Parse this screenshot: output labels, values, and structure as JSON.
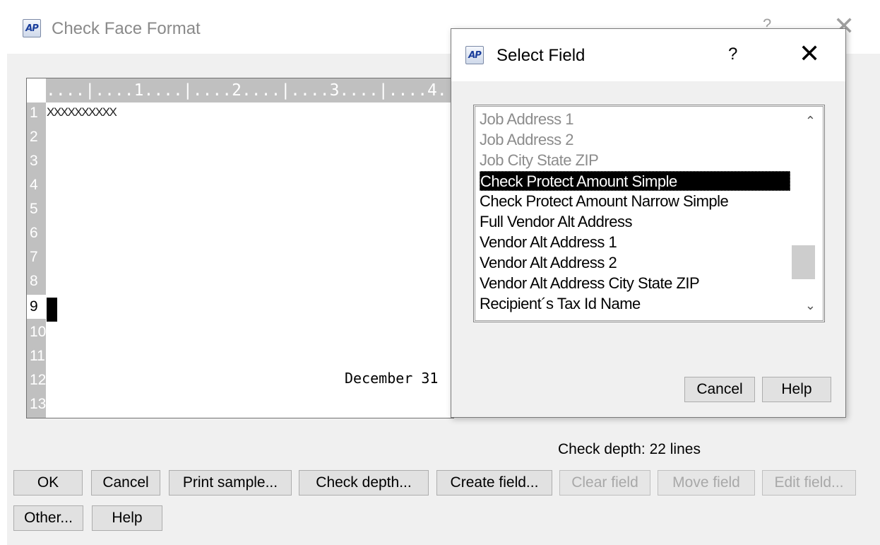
{
  "main": {
    "title": "Check Face Format",
    "help": "?",
    "close": "✕",
    "icon_text": "AP"
  },
  "editor": {
    "ruler": "....|....1....|....2....|....3....|....4....",
    "lines": [
      "1",
      "2",
      "3",
      "4",
      "5",
      "6",
      "7",
      "8",
      "9",
      "10",
      "11",
      "12",
      "13"
    ],
    "active_line": "9",
    "line1_text": "XXXXXXXXXX",
    "date_text": "December 31"
  },
  "status": {
    "check_depth": "Check depth: 22 lines"
  },
  "buttons": {
    "ok": "OK",
    "cancel": "Cancel",
    "print_sample": "Print sample...",
    "check_depth": "Check depth...",
    "create_field": "Create field...",
    "clear_field": "Clear field",
    "move_field": "Move field",
    "edit_field": "Edit field...",
    "other": "Other...",
    "help": "Help"
  },
  "dialog": {
    "title": "Select Field",
    "help": "?",
    "close": "✕",
    "icon_text": "AP",
    "items": [
      {
        "label": "Job Address 1",
        "state": "gray"
      },
      {
        "label": "Job Address 2",
        "state": "gray"
      },
      {
        "label": "Job City State ZIP",
        "state": "gray"
      },
      {
        "label": "Check Protect Amount Simple",
        "state": "selected"
      },
      {
        "label": "Check Protect Amount Narrow Simple",
        "state": "normal"
      },
      {
        "label": "Full Vendor Alt Address",
        "state": "normal"
      },
      {
        "label": "Vendor Alt Address 1",
        "state": "normal"
      },
      {
        "label": "Vendor Alt Address 2",
        "state": "normal"
      },
      {
        "label": "Vendor Alt Address City State ZIP",
        "state": "normal"
      },
      {
        "label": "Recipient´s Tax Id Name",
        "state": "normal"
      }
    ],
    "cancel": "Cancel",
    "help_button": "Help",
    "scroll_up": "⌃",
    "scroll_down": "⌄"
  }
}
